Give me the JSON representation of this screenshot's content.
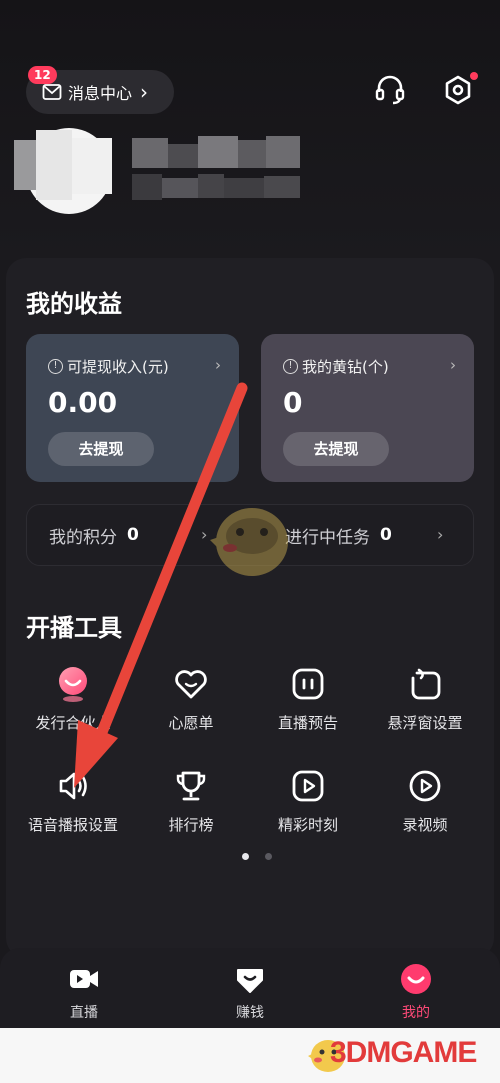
{
  "header": {
    "message_badge": "12",
    "message_label": "消息中心",
    "message_chevron": "›"
  },
  "earnings": {
    "title": "我的收益",
    "cash": {
      "label": "可提现收入(元)",
      "value": "0.00",
      "button": "去提现"
    },
    "gold": {
      "label": "我的黄钻(个)",
      "value": "0",
      "button": "去提现"
    }
  },
  "points": {
    "points_label": "我的积分",
    "points_value": "0",
    "tasks_label": "进行中任务",
    "tasks_value": "0"
  },
  "tools": {
    "title": "开播工具",
    "items": [
      {
        "label": "发行合伙人",
        "icon": "partner-icon"
      },
      {
        "label": "心愿单",
        "icon": "wish-list-icon"
      },
      {
        "label": "直播预告",
        "icon": "live-preview-icon"
      },
      {
        "label": "悬浮窗设置",
        "icon": "floating-window-icon"
      },
      {
        "label": "语音播报设置",
        "icon": "voice-broadcast-icon"
      },
      {
        "label": "排行榜",
        "icon": "trophy-icon"
      },
      {
        "label": "精彩时刻",
        "icon": "highlight-play-icon"
      },
      {
        "label": "录视频",
        "icon": "record-video-icon"
      }
    ],
    "page_count": 2,
    "active_page": 1
  },
  "tabbar": {
    "tabs": [
      {
        "label": "直播",
        "icon": "live-camera-icon"
      },
      {
        "label": "赚钱",
        "icon": "earn-icon"
      },
      {
        "label": "我的",
        "icon": "profile-smile-icon"
      }
    ],
    "active_tab": 2
  },
  "watermark": {
    "text": "3DMGAME"
  },
  "colors": {
    "background": "#1a191d",
    "accent": "#ff4a78",
    "badge": "#ff3b5c",
    "annotation_arrow": "#e8453a"
  }
}
